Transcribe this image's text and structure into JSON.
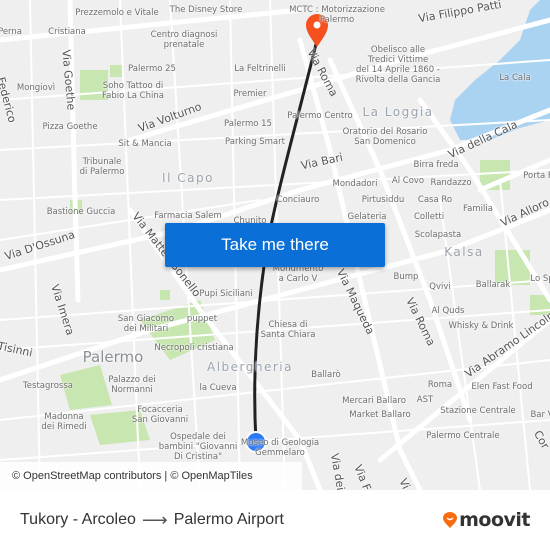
{
  "map": {
    "labels": [
      "Prezzemolo e Vitale",
      "The Disney Store",
      "Cristiana",
      "Perna",
      "Centro diagnosi\nprenatale",
      "Palermo 25",
      "La Feltrinelli",
      "Soho Tattoo di\nFabio La China",
      "Mongiovì",
      "Premier",
      "Pizza Goethe",
      "Palermo 15",
      "Sit & Mancia",
      "Parking Smart",
      "Tribunale\ndi Palermo",
      "Bastione Guccia",
      "Farmacia Salem",
      "Chunito",
      "Pupi Siciliani",
      "San Giacomo\ndei Militari",
      "puppet",
      "Necropoli cristiana",
      "Testagrossa",
      "Palazzo dei\nNormanni",
      "la Cueva",
      "Focacceria\nSan Giovanni",
      "Madonna\ndei Rimedi",
      "Ospedale dei\nbambini \"Giovanni\nDi Cristina\"",
      "Museo di Geologia\nGemmelaro",
      "MCTC : Motorizzazione\nPalermo",
      "Obelisco alle\nTredici Vittime\ndel 14 Aprile 1860 -\nRivolta della Gancia",
      "La Cala",
      "Palermo Centro",
      "Oratorio del Rosario\nSan Domenico",
      "Birra freda",
      "Porta F",
      "Mondadori",
      "Al Covo",
      "Randazzo",
      "Conciauro",
      "Pirtusiddu",
      "Casa Ro",
      "Familia",
      "Gelateria",
      "Colletti",
      "Scolapasta",
      "Monumento\na Carlo V",
      "Bump",
      "Qvivi",
      "Ballarak",
      "Lo Sp",
      "Al Quds",
      "Whisky & Drink",
      "Chiesa di\nSanta Chiara",
      "Ballarò",
      "Roma",
      "Elen Fast Food",
      "Mercari Ballaro",
      "AST",
      "Stazione Centrale",
      "Market Ballaro",
      "Palermo Centrale",
      "Bar V"
    ],
    "roads": [
      "Via Goethe",
      "Via Volturno",
      "Via Matteo Bonello",
      "Via D'Ossuna",
      "Via Imera",
      "Tisinni",
      "Federico",
      "Via Filippo Patti",
      "Via Roma",
      "Via della Cala",
      "Via Bari",
      "Via Alloro",
      "Via Maqueda",
      "Via Roma",
      "Via Abramo Lincoln",
      "Via dei",
      "Via F",
      "Vi",
      "Cor"
    ],
    "districts": [
      "Il Capo",
      "La Loggia",
      "Kalsa",
      "Albergheria"
    ],
    "city": "Palermo",
    "colors": {
      "water": "#aad3f2",
      "park": "#c8e6b0",
      "route": "#222222",
      "origin": "#2b7af5",
      "destination": "#f4511e"
    }
  },
  "cta": {
    "label": "Take me there"
  },
  "attribution": "© OpenStreetMap contributors | © OpenMapTiles",
  "footer": {
    "origin": "Tukory - Arcoleo",
    "arrow": "⟶",
    "destination": "Palermo Airport",
    "brand": "moovit",
    "brand_color": "#f96b0f"
  }
}
